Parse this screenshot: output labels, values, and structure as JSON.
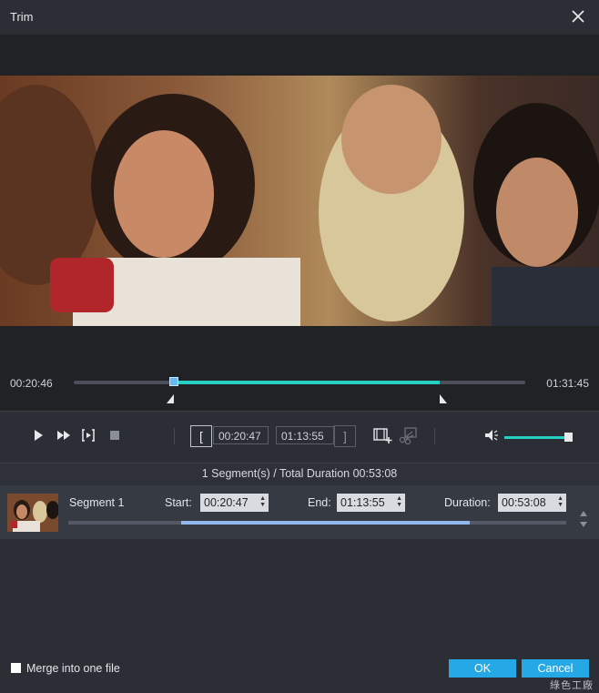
{
  "window": {
    "title": "Trim"
  },
  "player": {
    "current_time": "00:20:46",
    "total_time": "01:31:45",
    "playhead_fraction": 0.222,
    "selection_start_fraction": 0.222,
    "selection_end_fraction": 0.81
  },
  "controls": {
    "icons": [
      "play-icon",
      "fast-forward-icon",
      "frame-step-icon",
      "stop-icon",
      "add-segment-icon",
      "split-scissors-icon",
      "volume-icon"
    ],
    "start_bracket": "[",
    "end_bracket": "]",
    "start_time": "00:20:47",
    "end_time": "01:13:55",
    "volume_fraction": 0.95,
    "accent_color": "#26d1c3"
  },
  "summary": {
    "text": "1 Segment(s) / Total Duration 00:53:08"
  },
  "segments": [
    {
      "name": "Segment 1",
      "start_label": "Start:",
      "start_value": "00:20:47",
      "end_label": "End:",
      "end_value": "01:13:55",
      "duration_label": "Duration:",
      "duration_value": "00:53:08",
      "range_start_fraction": 0.227,
      "range_end_fraction": 0.806
    }
  ],
  "footer": {
    "merge_label": "Merge into one file",
    "merge_checked": false,
    "ok_label": "OK",
    "cancel_label": "Cancel",
    "button_color": "#25a8e6",
    "watermark": "綠色工廠"
  }
}
